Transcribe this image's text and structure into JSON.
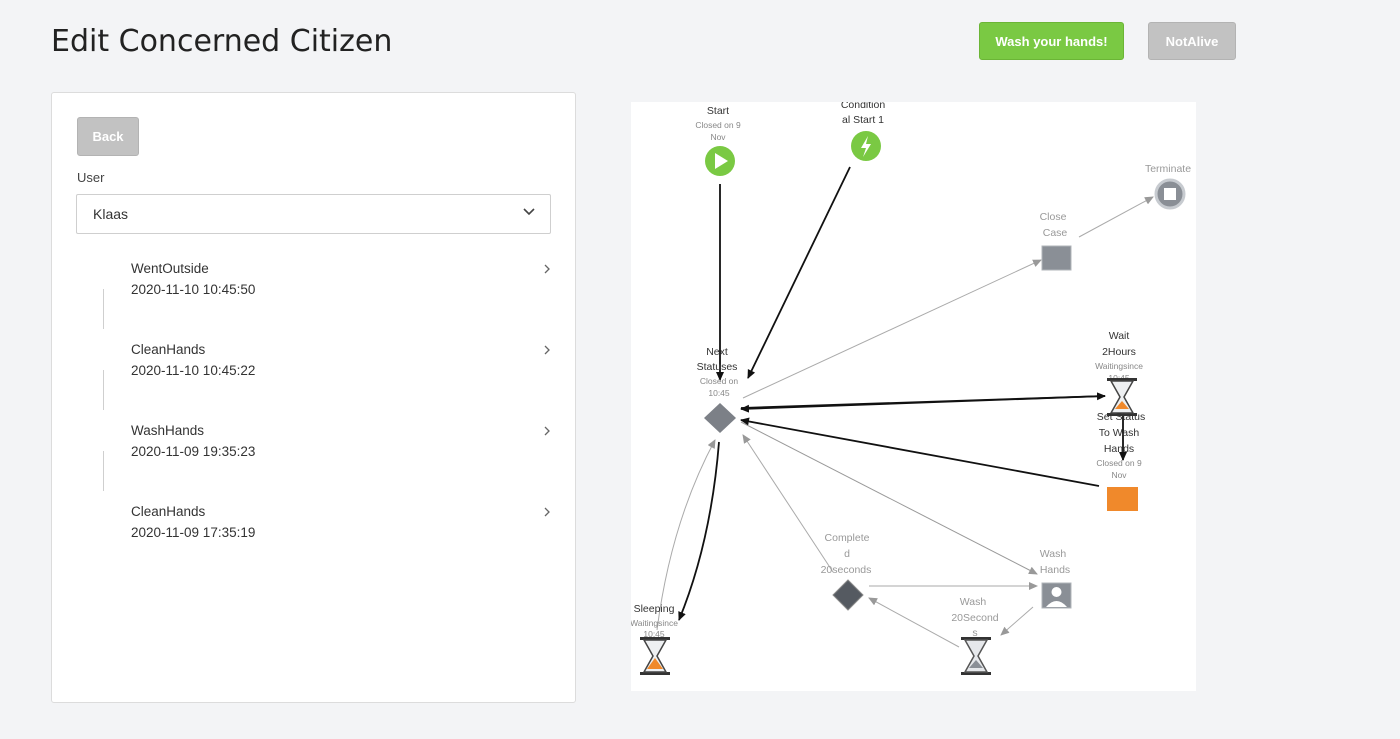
{
  "page": {
    "title": "Edit Concerned Citizen"
  },
  "actions": {
    "wash_label": "Wash your hands!",
    "notalive_label": "NotAlive"
  },
  "panel": {
    "back_label": "Back",
    "user_label": "User",
    "user_value": "Klaas",
    "history": [
      {
        "name": "WentOutside",
        "time": "2020-11-10 10:45:50"
      },
      {
        "name": "CleanHands",
        "time": "2020-11-10 10:45:22"
      },
      {
        "name": "WashHands",
        "time": "2020-11-09 19:35:23"
      },
      {
        "name": "CleanHands",
        "time": "2020-11-09 17:35:19"
      }
    ]
  },
  "diagram": {
    "start": {
      "l1": "Start",
      "s1": "Closed on 9",
      "s2": "Nov"
    },
    "cond_start": {
      "l1": "Condition",
      "l2": "al Start 1"
    },
    "terminate": {
      "l1": "Terminate"
    },
    "close_case": {
      "l1": "Close",
      "l2": "Case"
    },
    "next_statuses": {
      "l1": "Next",
      "l2": "Statuses",
      "s1": "Closed on",
      "s2": "10:45"
    },
    "wait_2hours": {
      "l1": "Wait",
      "l2": "2Hours",
      "s1": "Waitingsince",
      "s2": "10:45"
    },
    "set_status": {
      "l1": "Set Status",
      "l2": "To Wash",
      "l3": "Hands",
      "s1": "Closed on 9",
      "s2": "Nov"
    },
    "completed": {
      "l1": "Complete",
      "l2": "d",
      "l3": "20seconds"
    },
    "wash_hands": {
      "l1": "Wash",
      "l2": "Hands"
    },
    "wash_20": {
      "l1": "Wash",
      "l2": "20Second",
      "l3": "s"
    },
    "sleeping": {
      "l1": "Sleeping",
      "s1": "Waitingsince",
      "s2": "10:45"
    }
  },
  "colors": {
    "green": "#7ac943",
    "orange": "#f0892b",
    "grey_button": "#c2c2c2"
  }
}
